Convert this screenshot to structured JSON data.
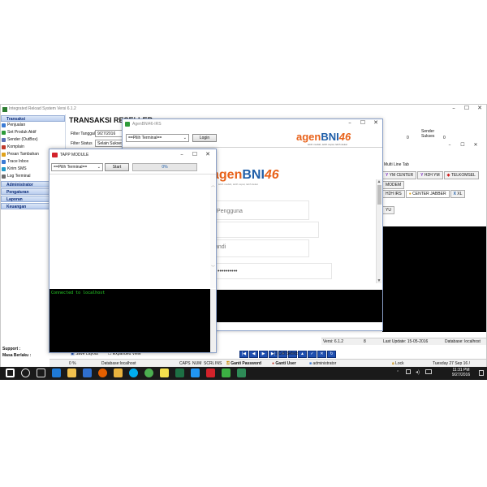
{
  "main_app": {
    "title": "Integrated Reload System Versi 6.1.2",
    "heading": "TRANSAKSI RESELLER",
    "filter_date_label": "Filter Tanggal",
    "filter_date_value": "9/27/2016",
    "filter_status_label": "Filter Status",
    "filter_status_value": "Selain Sukses / ...",
    "sidebar": {
      "transaksi_head": "Transaksi",
      "items": [
        "Penjualan",
        "Set Produk Aktif",
        "Sender (OutBox)",
        "Komplain",
        "Pesan Tambahan",
        "Trace Inbox",
        "Kirim SMS",
        "Log Terminal"
      ],
      "administrator": "Administrator",
      "pengaturan": "Pengaturan",
      "laporan": "Laporan",
      "keuangan": "Keuangan"
    },
    "support_label": "Support :",
    "masa_berlaku_label": "Masa Berlaku :",
    "right_panel": {
      "col1": "Sender",
      "col1b": "Sukses",
      "val_a": "0",
      "val_b": "0",
      "multi_line_tab": "Multi Line Tab",
      "tabs_row1": [
        "YM CENTER",
        "H2H YM",
        "TELKOMSEL"
      ],
      "modem_tab": "MODEM",
      "tabs_row2": [
        "H2H IRS",
        "CENTER JABBER",
        "XL"
      ],
      "yu_tab": "YU"
    },
    "status": {
      "versi": "Versi: 6.1.2",
      "num": "8",
      "last_update": "Last Update: 15-05-2016",
      "database": "Database: localhost",
      "bottom_left": "Database:localhost",
      "caps": "CAPS",
      "num_lbl": "NUM",
      "scrl": "SCRL",
      "ins": "INS",
      "pct": "0 %"
    },
    "toolbar": {
      "save_layout": "Save Layout",
      "expanded_view": "Expanded View",
      "cell_select": "Cell Select"
    },
    "footer_links": {
      "ganti_password": "Ganti Password",
      "ganti_user": "Ganti User",
      "admin": "administrator",
      "lock": "Lock",
      "datetime": "Tuesday 27 Sep 16 / 23:31:15"
    }
  },
  "agen_window": {
    "title": "AgenBNI46-IRS",
    "terminal_select": "==Pilih Terminal==",
    "login_button": "Login",
    "logo_prefix": "agen",
    "logo_bni": "BNI",
    "logo_46": "46",
    "tagline": "lebih mudah, lebih cepat, lebih dekat",
    "field1_label": "Pengguna",
    "field2_label": "andi",
    "password_mask": "••••••••••",
    "colors": {
      "accent": "#e8621a",
      "brand_blue": "#1f5ea8"
    }
  },
  "tapp_window": {
    "title": "TAPP MODULE",
    "terminal_select": "==Pilih Terminal==",
    "start_button": "Start",
    "progress_text": "0%",
    "progress": 0,
    "log_text": "Connected to localhost",
    "colors": {
      "log_text": "#27d627",
      "log_bg": "#000000"
    }
  },
  "taskbar": {
    "time": "11:31 PM",
    "date": "9/27/2016",
    "icons": [
      "windows-start-icon",
      "search-icon",
      "task-view-icon",
      "edge-icon",
      "file-explorer-icon",
      "store-icon",
      "firefox-icon",
      "folder-icon",
      "skype-icon",
      "chrome-icon",
      "sticky-notes-icon",
      "excel-icon",
      "app-icon",
      "tapp-icon",
      "settings-icon",
      "shield-icon"
    ]
  }
}
